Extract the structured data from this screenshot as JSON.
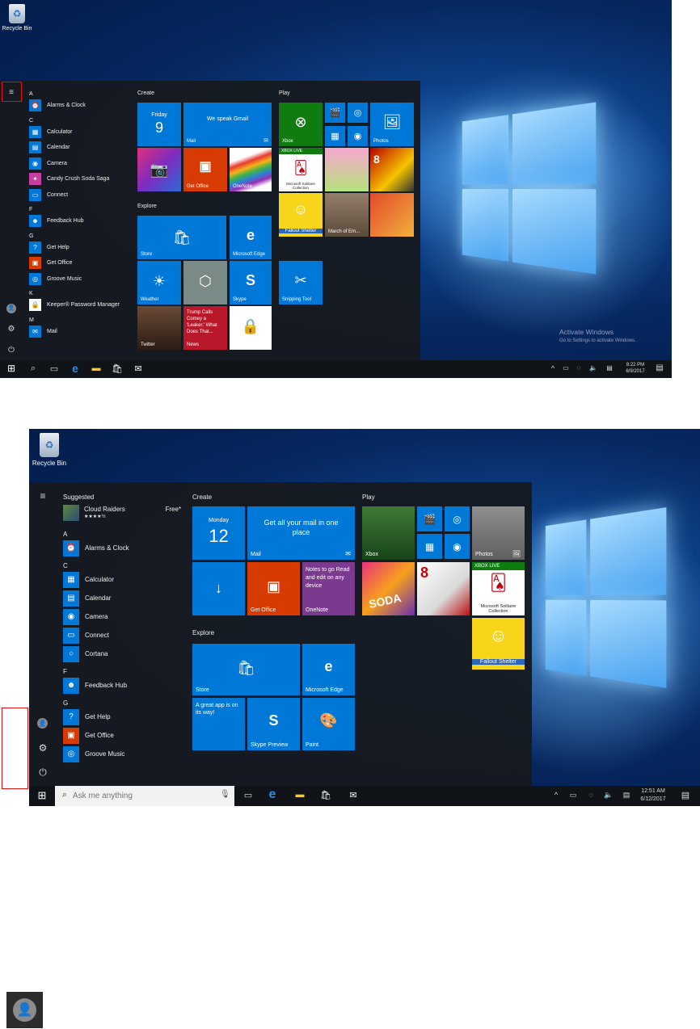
{
  "screen1": {
    "desktop": {
      "recycle_bin_label": "Recycle Bin",
      "watermark_title": "Activate Windows",
      "watermark_body": "Go to Settings to activate Windows."
    },
    "rail_icons": [
      "menu-icon",
      "user-icon",
      "gear-icon",
      "power-icon"
    ],
    "apps": [
      {
        "type": "letter",
        "text": "A"
      },
      {
        "type": "app",
        "text": "Alarms & Clock",
        "icon": "alarm-icon"
      },
      {
        "type": "letter",
        "text": "C"
      },
      {
        "type": "app",
        "text": "Calculator",
        "icon": "calculator-icon"
      },
      {
        "type": "app",
        "text": "Calendar",
        "icon": "calendar-icon"
      },
      {
        "type": "app",
        "text": "Camera",
        "icon": "camera-icon"
      },
      {
        "type": "app",
        "text": "Candy Crush Soda Saga",
        "icon": "candy-icon"
      },
      {
        "type": "app",
        "text": "Connect",
        "icon": "connect-icon"
      },
      {
        "type": "letter",
        "text": "F"
      },
      {
        "type": "app",
        "text": "Feedback Hub",
        "icon": "feedback-icon"
      },
      {
        "type": "letter",
        "text": "G"
      },
      {
        "type": "app",
        "text": "Get Help",
        "icon": "help-icon"
      },
      {
        "type": "app",
        "text": "Get Office",
        "icon": "office-icon"
      },
      {
        "type": "app",
        "text": "Groove Music",
        "icon": "music-icon"
      },
      {
        "type": "letter",
        "text": "K"
      },
      {
        "type": "app",
        "text": "Keeper® Password Manager",
        "icon": "lock-icon"
      },
      {
        "type": "letter",
        "text": "M"
      },
      {
        "type": "app",
        "text": "Mail",
        "icon": "mail-icon"
      }
    ],
    "groups": {
      "create": "Create",
      "play": "Play",
      "explore": "Explore"
    },
    "tiles": {
      "calendar_day": "Friday",
      "calendar_num": "9",
      "mail_text": "We speak Gmail",
      "mail_label": "Mail",
      "office": "Get Office",
      "onenote": "OneNote",
      "store": "Store",
      "edge": "Microsoft Edge",
      "weather": "Weather",
      "skype": "Skype",
      "twitter": "Twitter",
      "news_text": "Trump Calls Comey a 'Leaker.' What Does That...",
      "news_label": "News",
      "xbox": "Xbox",
      "photos": "Photos",
      "xbox_live": "XBOX LIVE",
      "solitaire": "Microsoft Solitaire Collection",
      "march": "March of Em...",
      "fallout": "Fallout Shelter",
      "snipping": "Snipping Tool"
    },
    "taskbar": {
      "time": "8:22 PM",
      "date": "6/9/2017"
    }
  },
  "screen2": {
    "desktop": {
      "recycle_bin_label": "Recycle Bin"
    },
    "suggested": {
      "heading": "Suggested",
      "app": "Cloud Raiders",
      "price": "Free*",
      "stars": "★★★★½"
    },
    "apps": [
      {
        "type": "letter",
        "text": "A"
      },
      {
        "type": "app",
        "text": "Alarms & Clock",
        "icon": "alarm-icon"
      },
      {
        "type": "letter",
        "text": "C"
      },
      {
        "type": "app",
        "text": "Calculator",
        "icon": "calculator-icon"
      },
      {
        "type": "app",
        "text": "Calendar",
        "icon": "calendar-icon"
      },
      {
        "type": "app",
        "text": "Camera",
        "icon": "camera-icon"
      },
      {
        "type": "app",
        "text": "Connect",
        "icon": "connect-icon"
      },
      {
        "type": "app",
        "text": "Cortana",
        "icon": "cortana-icon"
      },
      {
        "type": "letter",
        "text": "F"
      },
      {
        "type": "app",
        "text": "Feedback Hub",
        "icon": "feedback-icon"
      },
      {
        "type": "letter",
        "text": "G"
      },
      {
        "type": "app",
        "text": "Get Help",
        "icon": "help-icon"
      },
      {
        "type": "app",
        "text": "Get Office",
        "icon": "office-icon"
      },
      {
        "type": "app",
        "text": "Groove Music",
        "icon": "music-icon"
      }
    ],
    "groups": {
      "create": "Create",
      "play": "Play",
      "explore": "Explore"
    },
    "tiles": {
      "calendar_day": "Monday",
      "calendar_num": "12",
      "mail_text": "Get all your mail in one place",
      "mail_label": "Mail",
      "office": "Get Office",
      "onenote_text": "Notes to go Read and edit on any device",
      "onenote": "OneNote",
      "store": "Store",
      "edge": "Microsoft Edge",
      "app_coming": "A great app is on its way!",
      "skype": "Skype Preview",
      "paint": "Paint",
      "xbox": "Xbox",
      "photos": "Photos",
      "xbox_live": "XBOX LIVE",
      "solitaire": "Microsoft Solitaire Collection",
      "fallout": "Fallout Shelter",
      "soda": "SODA"
    },
    "taskbar": {
      "search_placeholder": "Ask me anything",
      "time": "12:51 AM",
      "date": "6/12/2017"
    }
  },
  "colors": {
    "accent": "#0078d7",
    "highlight": "#e01010",
    "start_bg": "#161a20"
  }
}
